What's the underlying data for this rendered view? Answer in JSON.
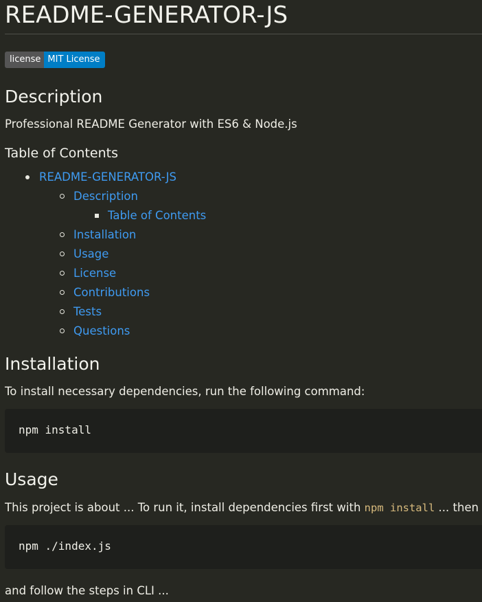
{
  "title": "README-GENERATOR-JS",
  "badge": {
    "label": "license",
    "message": "MIT License",
    "label_color": "#555555",
    "message_color": "#007ec6"
  },
  "description": {
    "heading": "Description",
    "text": "Professional README Generator with ES6 & Node.js"
  },
  "toc": {
    "heading": "Table of Contents",
    "items": [
      "README-GENERATOR-JS",
      "Description",
      "Table of Contents",
      "Installation",
      "Usage",
      "License",
      "Contributions",
      "Tests",
      "Questions"
    ]
  },
  "installation": {
    "heading": "Installation",
    "text": "To install necessary dependencies, run the following command:",
    "code": "npm install"
  },
  "usage": {
    "heading": "Usage",
    "text_before": "This project is about ... To run it, install dependencies first with ",
    "inline_code": "npm install",
    "text_after": " ... then type",
    "code": "npm ./index.js",
    "follow_text": "and follow the steps in CLI ..."
  },
  "colors": {
    "background": "#272822",
    "link": "#3f9bf2",
    "code_background": "#1e1f1c",
    "inline_code": "#d7ba7d"
  }
}
